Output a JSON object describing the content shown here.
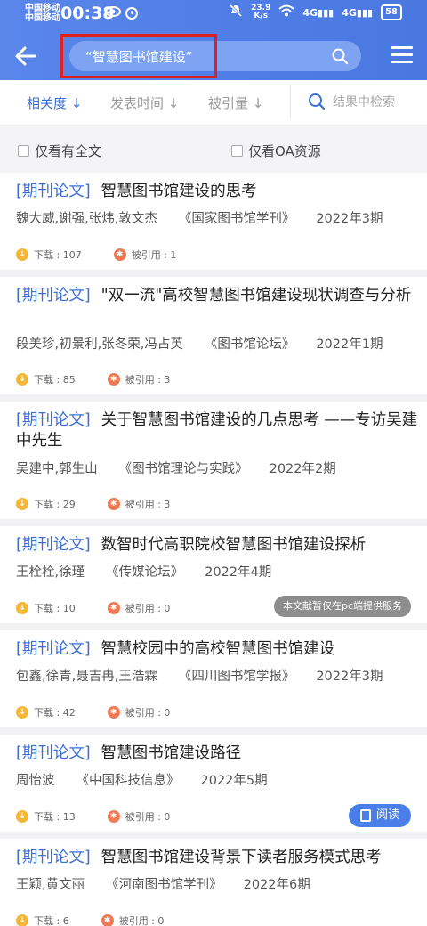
{
  "status_bar": {
    "carrier1": "中国移动",
    "carrier2": "中国移动",
    "time": "00:38",
    "net_speed": "23.9",
    "net_unit": "K/s",
    "sig1": "4G",
    "sig2": "4G",
    "battery": "58"
  },
  "header": {
    "search_text": "“智慧图书馆建设”"
  },
  "sort": {
    "relevance": "相关度",
    "publish_time": "发表时间",
    "citations": "被引量",
    "search_in_results": "结果中检索"
  },
  "filters": {
    "full_text": "仅看有全文",
    "oa": "仅看OA资源"
  },
  "results": [
    {
      "tag": "[期刊论文]",
      "title": "智慧图书馆建设的思考",
      "authors": "魏大威,谢强,张炜,敦文杰",
      "journal": "《国家图书馆学刊》",
      "date": "2022年3期",
      "downloads": "下载 : 107",
      "citations": "被引用 : 1"
    },
    {
      "tag": "[期刊论文]",
      "title": "\"双一流\"高校智慧图书馆建设现状调查与分析",
      "authors": "段美珍,初景利,张冬荣,冯占英",
      "journal": "《图书馆论坛》",
      "date": "2022年1期",
      "downloads": "下载 : 85",
      "citations": "被引用 : 3"
    },
    {
      "tag": "[期刊论文]",
      "title": "关于智慧图书馆建设的几点思考 ——专访吴建中先生",
      "authors": "吴建中,郭生山",
      "journal": "《图书馆理论与实践》",
      "date": "2022年2期",
      "downloads": "下载 : 29",
      "citations": "被引用 : 3"
    },
    {
      "tag": "[期刊论文]",
      "title": "数智时代高职院校智慧图书馆建设探析",
      "authors": "王栓栓,徐瑾",
      "journal": "《传媒论坛》",
      "date": "2022年4期",
      "downloads": "下载 : 10",
      "citations": "被引用 : 0",
      "notice": "本文献暂仅在pc端提供服务"
    },
    {
      "tag": "[期刊论文]",
      "title": "智慧校园中的高校智慧图书馆建设",
      "authors": "包鑫,徐青,聂吉冉,王浩霖",
      "journal": "《四川图书馆学报》",
      "date": "2022年3期",
      "downloads": "下载 : 42",
      "citations": "被引用 : 0"
    },
    {
      "tag": "[期刊论文]",
      "title": "智慧图书馆建设路径",
      "authors": "周怡波",
      "journal": "《中国科技信息》",
      "date": "2022年5期",
      "downloads": "下载 : 13",
      "citations": "被引用 : 0",
      "read_label": "阅读"
    },
    {
      "tag": "[期刊论文]",
      "title": "智慧图书馆建设背景下读者服务模式思考",
      "authors": "王颖,黄文丽",
      "journal": "《河南图书馆学刊》",
      "date": "2022年6期",
      "downloads": "下载 : 6",
      "citations": "被引用 : 0"
    }
  ]
}
